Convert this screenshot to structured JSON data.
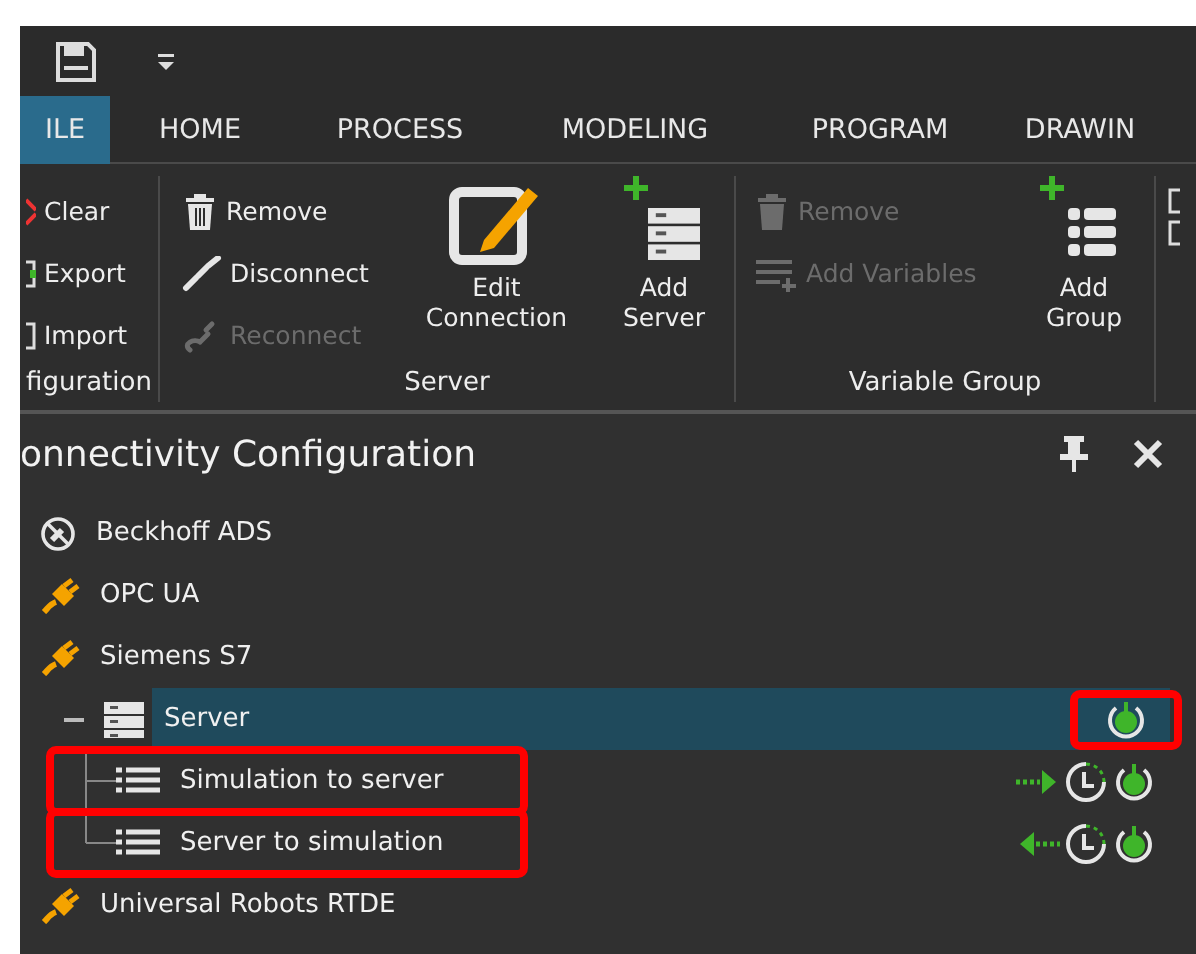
{
  "tabs": [
    {
      "label": "ILE",
      "selected": true
    },
    {
      "label": "HOME",
      "selected": false
    },
    {
      "label": "PROCESS",
      "selected": false
    },
    {
      "label": "MODELING",
      "selected": false
    },
    {
      "label": "PROGRAM",
      "selected": false
    },
    {
      "label": "DRAWIN",
      "selected": false
    }
  ],
  "ribbon_groups": [
    {
      "label": "figuration",
      "commands": [
        {
          "label": "Clear",
          "kind": "small",
          "disabled": false
        },
        {
          "label": "Export",
          "kind": "small",
          "disabled": false
        },
        {
          "label": "Import",
          "kind": "small",
          "disabled": false
        }
      ]
    },
    {
      "label": "Server",
      "commands": [
        {
          "label": "Remove",
          "kind": "small",
          "disabled": false
        },
        {
          "label": "Disconnect",
          "kind": "small",
          "disabled": false
        },
        {
          "label": "Reconnect",
          "kind": "small",
          "disabled": true
        },
        {
          "label": "Edit Connection",
          "kind": "large",
          "disabled": false
        },
        {
          "label": "Add Server",
          "kind": "large",
          "disabled": false
        }
      ]
    },
    {
      "label": "Variable Group",
      "commands": [
        {
          "label": "Remove",
          "kind": "small",
          "disabled": true
        },
        {
          "label": "Add Variables",
          "kind": "small",
          "disabled": true
        },
        {
          "label": "Add Group",
          "kind": "large",
          "disabled": false
        }
      ]
    }
  ],
  "panel": {
    "title": "onnectivity Configuration"
  },
  "tree": [
    {
      "label": "Beckhoff ADS",
      "kind": "disconnected-driver",
      "selected": false,
      "highlighted": false
    },
    {
      "label": "OPC UA",
      "kind": "driver",
      "selected": false,
      "highlighted": false
    },
    {
      "label": "Siemens S7",
      "kind": "driver",
      "selected": false,
      "highlighted": false,
      "children": [
        {
          "label": "Server",
          "kind": "server",
          "selected": true,
          "expanded": true,
          "highlighted": false,
          "status_highlighted": true,
          "children": [
            {
              "label": "Simulation to server",
              "kind": "variable-group",
              "selected": false,
              "highlighted": true,
              "status": [
                {
                  "kind": "send"
                },
                {
                  "kind": "timer"
                },
                {
                  "kind": "power"
                }
              ]
            },
            {
              "label": "Server to simulation",
              "kind": "variable-group",
              "selected": false,
              "highlighted": true,
              "status": [
                {
                  "kind": "receive"
                },
                {
                  "kind": "timer"
                },
                {
                  "kind": "power"
                }
              ]
            }
          ]
        }
      ]
    },
    {
      "label": "Universal Robots RTDE",
      "kind": "driver",
      "selected": false,
      "highlighted": false
    }
  ]
}
